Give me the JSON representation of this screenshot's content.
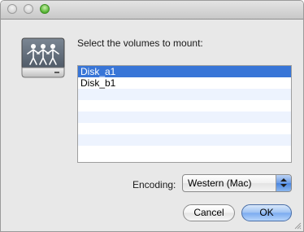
{
  "dialog": {
    "prompt": "Select the volumes to mount:",
    "volumes": [
      "Disk_a1",
      "Disk_b1",
      "",
      "",
      "",
      "",
      "",
      ""
    ],
    "selected_index": 0,
    "encoding_label": "Encoding:",
    "encoding_value": "Western (Mac)",
    "cancel_label": "Cancel",
    "ok_label": "OK"
  },
  "icons": {
    "drive": "network-share-drive-icon",
    "close": "close-button-icon",
    "minimize": "minimize-button-icon",
    "zoom": "zoom-button-icon"
  },
  "colors": {
    "selection": "#3875d7",
    "alternate_row": "#edf3fe",
    "default_button": "#7aaaf0",
    "zoom_light": "#52b330"
  }
}
